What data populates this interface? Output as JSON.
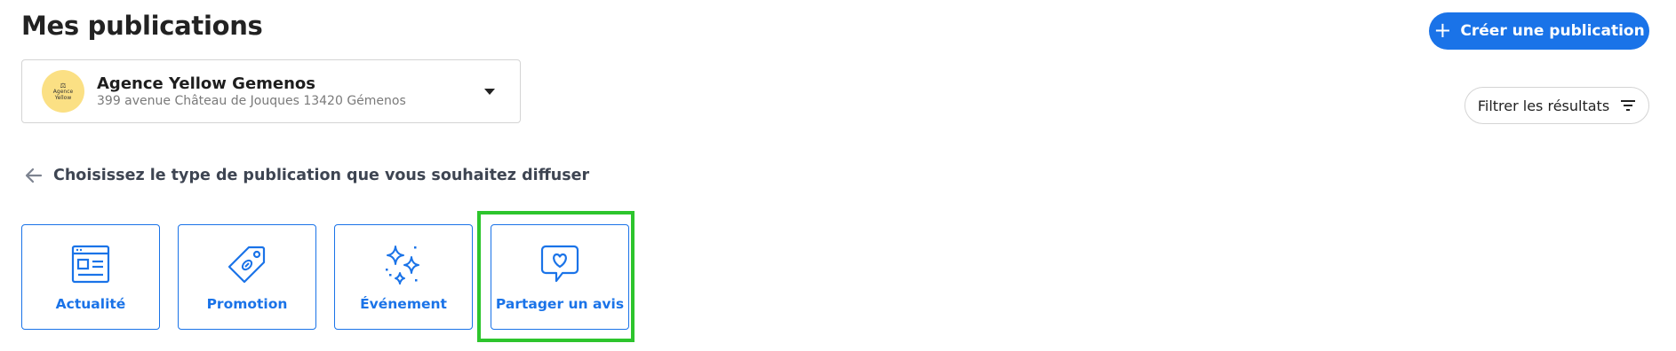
{
  "header": {
    "title": "Mes publications",
    "create_button_label": "Créer une publication",
    "create_button_icon": "plus-icon"
  },
  "agency": {
    "name": "Agence Yellow Gemenos",
    "address": "399 avenue Château de Jouques 13420 Gémenos",
    "logo_text_line1": "Agence",
    "logo_text_line2": "Yellow",
    "logo_color": "#fbe084"
  },
  "filter": {
    "label": "Filtrer les résultats",
    "icon": "filter-lines-icon"
  },
  "prompt": {
    "label": "Choisissez le type de publication que vous souhaitez diffuser",
    "back_icon": "arrow-left-icon"
  },
  "publication_types": [
    {
      "label": "Actualité",
      "icon": "newspaper-window-icon"
    },
    {
      "label": "Promotion",
      "icon": "price-tag-icon"
    },
    {
      "label": "Événement",
      "icon": "sparkles-icon"
    },
    {
      "label": "Partager un avis",
      "icon": "heart-speech-bubble-icon",
      "highlighted": true
    }
  ],
  "colors": {
    "accent": "#1a73e8",
    "highlight": "#2dc52d",
    "border": "#d4d4d4"
  }
}
